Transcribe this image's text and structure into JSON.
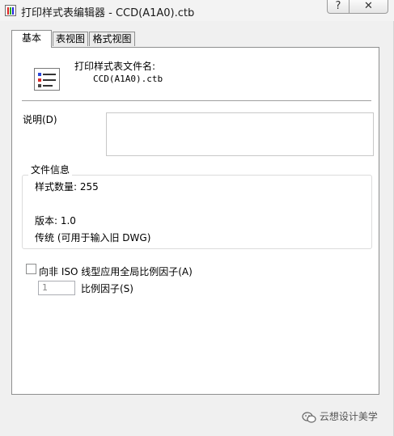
{
  "window": {
    "title": "打印样式表编辑器 - CCD(A1A0).ctb",
    "help_glyph": "?",
    "close_glyph": "✕"
  },
  "tabs": [
    {
      "label": "基本",
      "active": true
    },
    {
      "label": "表视图",
      "active": false
    },
    {
      "label": "格式视图",
      "active": false
    }
  ],
  "general": {
    "file_name_label": "打印样式表文件名:",
    "file_name_value": "CCD(A1A0).ctb",
    "description_label": "说明(D)",
    "description_value": "",
    "file_info": {
      "group_title": "文件信息",
      "style_count": "样式数量: 255",
      "version": "版本: 1.0",
      "legacy": "传统 (可用于输入旧 DWG)"
    },
    "apply_scale": {
      "label": "向非 ISO 线型应用全局比例因子(A)",
      "checked": false
    },
    "scale_factor": {
      "value": "1",
      "label": "比例因子(S)"
    }
  },
  "watermark": {
    "text": "云想设计美学",
    "icon": "wechat-icon"
  }
}
